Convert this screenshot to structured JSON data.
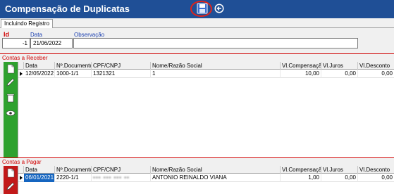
{
  "window": {
    "title": "Compensação de Duplicatas"
  },
  "tabs": [
    {
      "label": "Incluindo Registro"
    }
  ],
  "form": {
    "id_label": "Id",
    "id_value": "-1",
    "data_label": "Data",
    "data_value": "21/06/2022",
    "obs_label": "Observação",
    "obs_value": ""
  },
  "receber": {
    "section_label": "Contas a Receber",
    "columns": [
      "Data",
      "Nº.Documento",
      "CPF/CNPJ",
      "Nome/Razão Social",
      "Vl.Compensação",
      "Vl.Juros",
      "Vl.Desconto"
    ],
    "rows": [
      {
        "data": "12/05/2022",
        "documento": "1000-1/1",
        "cpf": "1321321",
        "nome": "1",
        "compensacao": "10,00",
        "juros": "0,00",
        "desconto": "0,00"
      }
    ]
  },
  "pagar": {
    "section_label": "Contas a Pagar",
    "columns": [
      "Data",
      "Nº.Documento",
      "CPF/CNPJ",
      "Nome/Razão Social",
      "Vl.Compensação",
      "Vl.Juros",
      "Vl.Desconto"
    ],
    "rows": [
      {
        "data": "06/01/2021",
        "documento": "2220-1/1",
        "cpf": "",
        "nome": "ANTONIO REINALDO VIANA",
        "compensacao": "1,00",
        "juros": "0,00",
        "desconto": "0,00"
      }
    ]
  },
  "icons": {
    "save": "save-icon",
    "back": "back-arrow-icon",
    "new": "new-document-icon",
    "edit": "pencil-icon",
    "delete": "trash-icon",
    "view": "eye-icon"
  },
  "colors": {
    "titlebar": "#1f4f96",
    "highlight": "#e0231a",
    "section_label": "#d00000",
    "field_label": "#1a3fb0",
    "receber_sidebar": "#2ea12e",
    "pagar_sidebar": "#c21919",
    "selection": "#1565c0"
  }
}
